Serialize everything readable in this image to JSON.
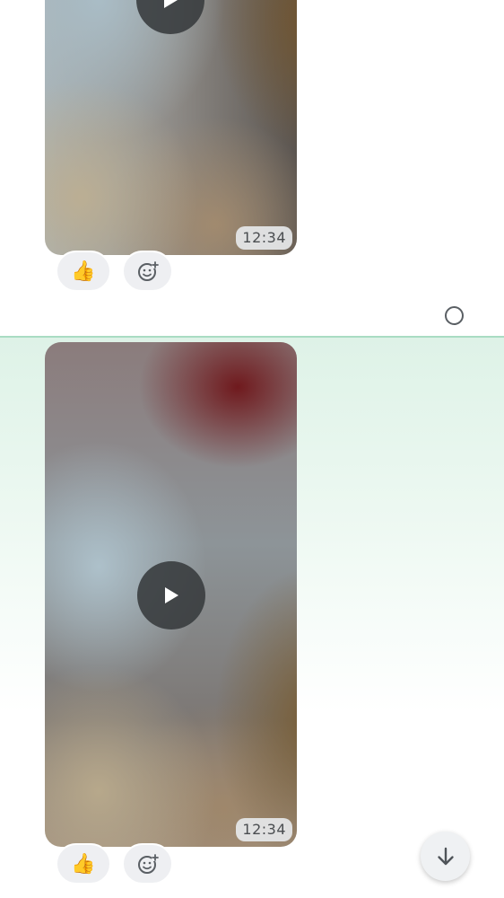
{
  "messages": [
    {
      "type": "video",
      "duration": "12:34",
      "reactions": {
        "primary_emoji": "👍",
        "add_icon": "add-reaction-icon"
      }
    },
    {
      "type": "video",
      "duration": "12:34",
      "reactions": {
        "primary_emoji": "👍",
        "add_icon": "add-reaction-icon"
      }
    }
  ],
  "selection": {
    "icon": "radio-unselected-icon"
  },
  "scroll_button": {
    "icon": "arrow-down-icon"
  },
  "colors": {
    "highlight_border": "#a9dcc3",
    "highlight_fill": "#def2e7",
    "pill_background": "#eeeff2",
    "icon_gray": "#5a5f64"
  }
}
